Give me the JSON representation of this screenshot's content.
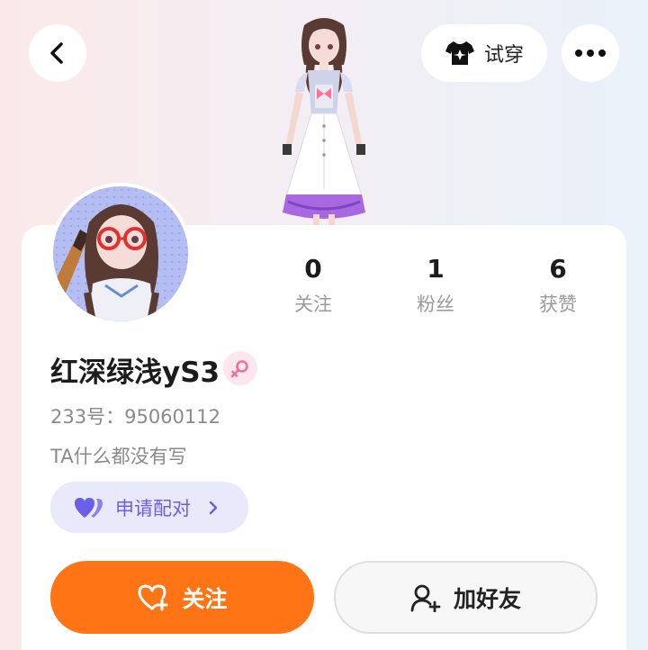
{
  "header": {
    "back_icon": "chevron-left-icon",
    "tryon_icon": "tshirt-icon",
    "tryon_label": "试穿",
    "more_icon": "more-dots-icon"
  },
  "profile": {
    "nickname": "红深绿浅yS3",
    "gender": "female",
    "id_label": "233号：",
    "id_value": "95060112",
    "bio": "TA什么都没有写"
  },
  "stats": [
    {
      "value": "0",
      "label": "关注"
    },
    {
      "value": "1",
      "label": "粉丝"
    },
    {
      "value": "6",
      "label": "获赞"
    }
  ],
  "pair_button": {
    "label": "申请配对",
    "icon": "double-heart-icon"
  },
  "actions": {
    "follow_label": "关注",
    "follow_icon": "heart-plus-icon",
    "add_friend_label": "加好友",
    "add_friend_icon": "user-plus-icon"
  },
  "colors": {
    "primary_orange": "#ff7414",
    "pair_purple": "#6b5ee8",
    "pair_bg": "#eae8fb",
    "gender_pink": "#f0709b"
  }
}
